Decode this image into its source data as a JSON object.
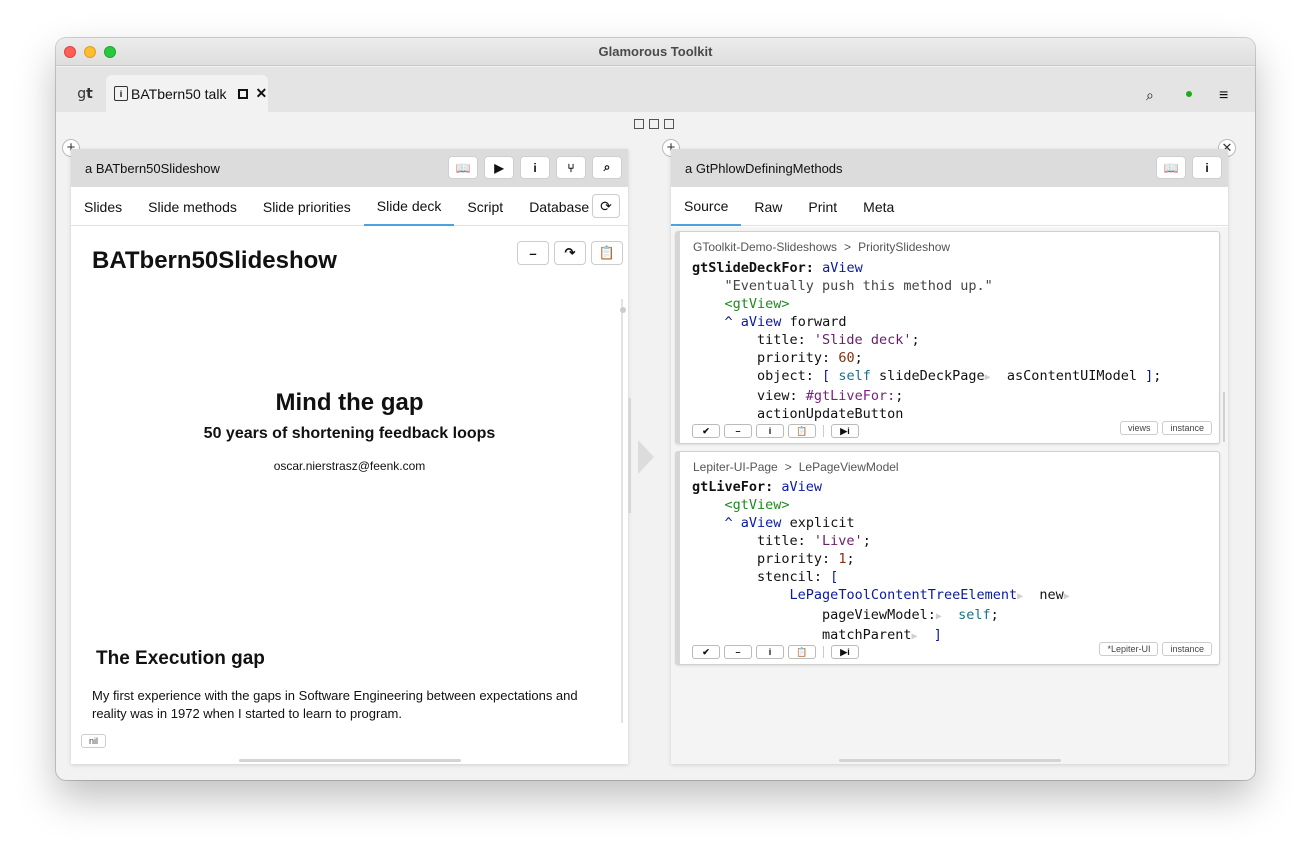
{
  "window": {
    "title": "Glamorous Toolkit",
    "traffic_lights": [
      "close",
      "minimize",
      "maximize"
    ]
  },
  "tabbar": {
    "home_tab_prefix": "g",
    "home_tab_suffix": "t",
    "active_tab": {
      "icon_glyph": "i",
      "label": "BATbern50 talk",
      "maximize_glyph": "",
      "close_glyph": "✕"
    },
    "right_icons": {
      "search": "⌕",
      "menu": "≡",
      "status_color": "#1cad1c"
    }
  },
  "left_pane": {
    "title": "a BATbern50Slideshow",
    "header_buttons": [
      {
        "name": "book-icon",
        "glyph": "📖"
      },
      {
        "name": "play-icon",
        "glyph": "▶"
      },
      {
        "name": "info-icon",
        "glyph": "i"
      },
      {
        "name": "git-branch-icon",
        "glyph": "⑂"
      },
      {
        "name": "search-icon",
        "glyph": "⌕"
      }
    ],
    "tabs": [
      "Slides",
      "Slide methods",
      "Slide priorities",
      "Slide deck",
      "Script",
      "Database"
    ],
    "active_tab": "Slide deck",
    "refresh_glyph": "⟳",
    "deck": {
      "title": "BATbern50Slideshow",
      "tools": [
        {
          "name": "minimize-icon",
          "glyph": "–"
        },
        {
          "name": "forward-icon",
          "glyph": "↷"
        },
        {
          "name": "clipboard-icon",
          "glyph": "📋"
        }
      ],
      "slide_heading": "Mind the gap",
      "slide_subheading": "50 years of shortening feedback loops",
      "slide_email": "oscar.nierstrasz@feenk.com",
      "next_slide_title": "The Execution gap",
      "next_slide_text": "My first experience with the gaps in Software Engineering between expectations and reality was in 1972 when I  started to learn to program.",
      "badge": "nil"
    }
  },
  "right_pane": {
    "title": "a GtPhlowDefiningMethods",
    "header_buttons": [
      {
        "name": "book-icon",
        "glyph": "📖"
      },
      {
        "name": "info-icon",
        "glyph": "i"
      }
    ],
    "tabs": [
      "Source",
      "Raw",
      "Print",
      "Meta"
    ],
    "active_tab": "Source",
    "cards": [
      {
        "crumb_package": "GToolkit-Demo-Slideshows",
        "crumb_sep": ">",
        "crumb_class": "PrioritySlideshow",
        "tags": [
          "views",
          "instance"
        ]
      },
      {
        "crumb_package": "Lepiter-UI-Page",
        "crumb_sep": ">",
        "crumb_class": "LePageViewModel",
        "tags": [
          "*Lepiter-UI",
          "instance"
        ]
      }
    ],
    "footer_buttons": [
      "✔",
      "–",
      "i",
      "📋",
      "▶i"
    ]
  },
  "colors": {
    "accent_tab_underline": "#4aa3df",
    "pane_header": "#dcdcdc",
    "code_keyword_blue": "#0a1aa0",
    "code_pragma_green": "#1e8a1e",
    "code_string": "#6a1b6a"
  }
}
